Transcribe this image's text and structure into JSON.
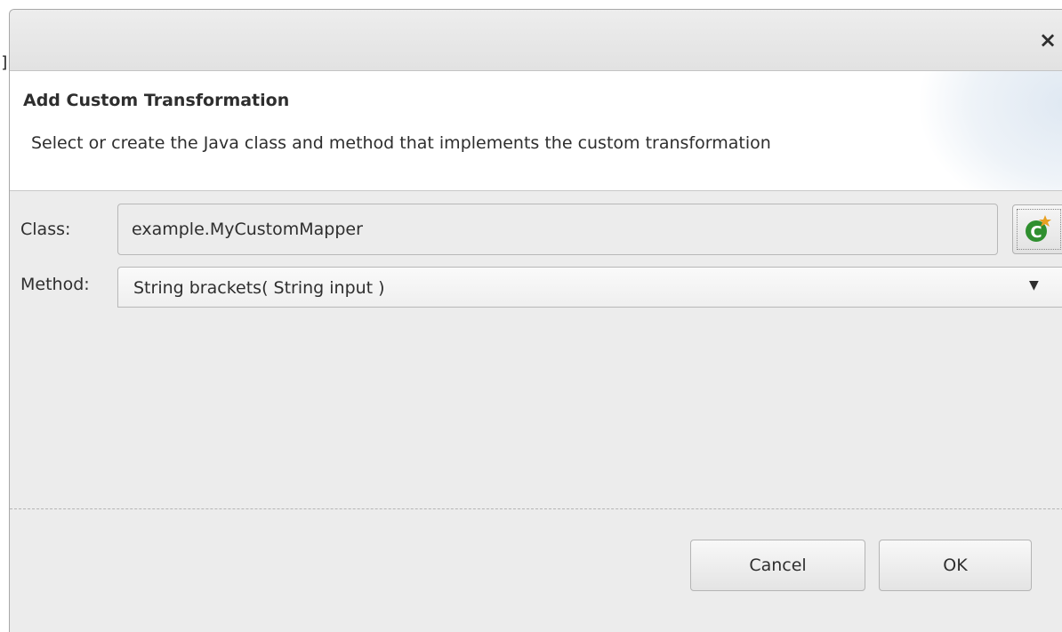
{
  "window": {
    "stray_char": "]",
    "close_glyph": "×"
  },
  "header": {
    "title": "Add Custom Transformation",
    "description": "Select or create the Java class and method that implements the custom transformation"
  },
  "form": {
    "class_label": "Class:",
    "class_value": "example.MyCustomMapper",
    "class_button_icon": "new-class-icon",
    "method_label": "Method:",
    "method_value": "String brackets( String input )",
    "method_arrow": "▼"
  },
  "buttons": {
    "cancel_label": "Cancel",
    "ok_label": "OK"
  },
  "colors": {
    "dialog_bg": "#ececec",
    "header_bg": "#ffffff",
    "icon_green": "#2f8f2f",
    "icon_accent": "#e8a020"
  }
}
